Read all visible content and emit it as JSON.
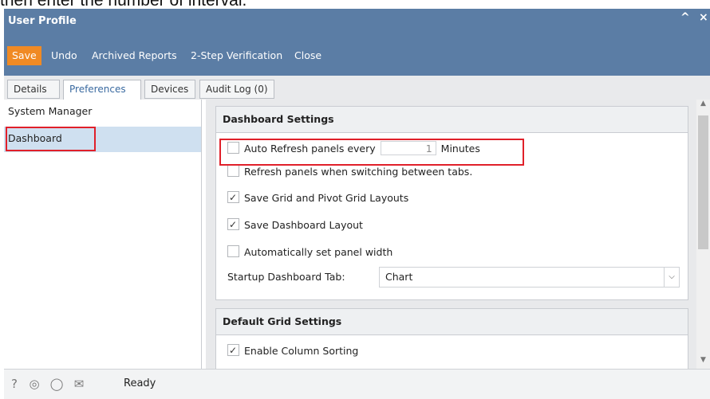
{
  "doc_snippet": "then enter the number of interval.",
  "window": {
    "title": "User Profile",
    "collapse_icon": "chevron-up-icon",
    "close_icon": "close-icon",
    "collapse_glyph": "^",
    "close_glyph": "×"
  },
  "toolbar": {
    "save_label": "Save",
    "undo_label": "Undo",
    "archived_reports_label": "Archived Reports",
    "two_step_label": "2-Step Verification",
    "close_label": "Close"
  },
  "tabs": [
    {
      "label": "Details"
    },
    {
      "label": "Preferences",
      "active": true
    },
    {
      "label": "Devices"
    },
    {
      "label": "Audit Log (0)"
    }
  ],
  "sidebar": {
    "items": [
      {
        "label": "System Manager"
      },
      {
        "label": "Dashboard",
        "selected": true
      }
    ]
  },
  "dashboard_settings": {
    "header": "Dashboard Settings",
    "auto_refresh": {
      "label": "Auto Refresh panels every",
      "value": "1",
      "unit": "Minutes",
      "checked": false
    },
    "refresh_on_switch": {
      "label": "Refresh panels when switching between tabs.",
      "checked": false
    },
    "save_grid_layouts": {
      "label": "Save Grid and Pivot Grid Layouts",
      "checked": true
    },
    "save_dashboard_layout": {
      "label": "Save Dashboard Layout",
      "checked": true
    },
    "auto_panel_width": {
      "label": "Automatically set panel width",
      "checked": false
    },
    "startup_tab": {
      "label": "Startup Dashboard Tab:",
      "value": "Chart"
    }
  },
  "default_grid_settings": {
    "header": "Default Grid Settings",
    "enable_column_sorting": {
      "label": "Enable Column Sorting",
      "checked": true
    }
  },
  "statusbar": {
    "status": "Ready",
    "icons": [
      "help-icon",
      "support-icon",
      "idea-icon",
      "mail-icon"
    ]
  },
  "colors": {
    "window_header": "#5b7da5",
    "save_button": "#f08a24",
    "selected_item": "#cfe0f0",
    "highlight_box": "#e0202a"
  }
}
